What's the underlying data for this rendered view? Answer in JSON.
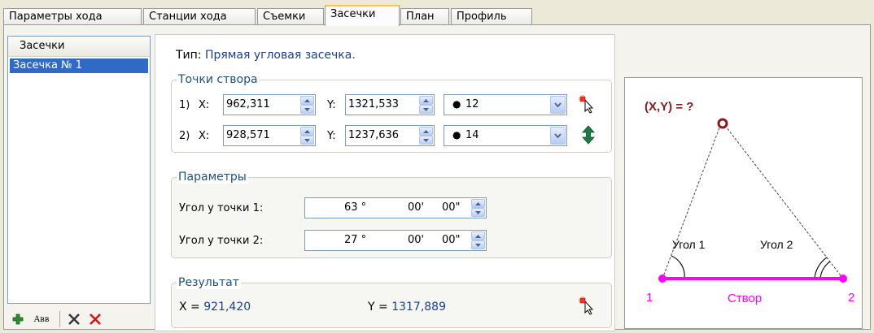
{
  "tabs": [
    "Параметры хода",
    "Станции хода",
    "Съемки",
    "Засечки",
    "План",
    "Профиль"
  ],
  "active_tab": 3,
  "list": {
    "header": "Засечки",
    "items": [
      "Засечка № 1"
    ],
    "toolbar": {
      "rename_label": "Авв"
    }
  },
  "type_line": {
    "label": "Тип:",
    "value": "Прямая угловая засечка."
  },
  "points": {
    "title": "Точки створа",
    "rows": [
      {
        "num": "1)",
        "x_label": "X:",
        "x": "962,311",
        "y_label": "Y:",
        "y": "1321,533",
        "station": "12"
      },
      {
        "num": "2)",
        "x_label": "X:",
        "x": "928,571",
        "y_label": "Y:",
        "y": "1237,636",
        "station": "14"
      }
    ]
  },
  "params": {
    "title": "Параметры",
    "rows": [
      {
        "label": "Угол у точки 1:",
        "deg": "63 °",
        "min": "00'",
        "sec": "00\""
      },
      {
        "label": "Угол у точки 2:",
        "deg": "27 °",
        "min": "00'",
        "sec": "00\""
      }
    ]
  },
  "result": {
    "title": "Результат",
    "x_label": "X =",
    "x": "921,420",
    "y_label": "Y =",
    "y": "1317,889"
  },
  "diagram": {
    "target_label": "(X,Y) = ?",
    "angle1": "Угол 1",
    "angle2": "Угол 2",
    "p1": "1",
    "p2": "2",
    "base_label": "Створ"
  },
  "colors": {
    "accent_magenta": "#ff00ff",
    "target_red": "#8b1a1a",
    "title_blue": "#1c5180",
    "value_blue": "#1c3f94",
    "selection": "#316ac5"
  }
}
